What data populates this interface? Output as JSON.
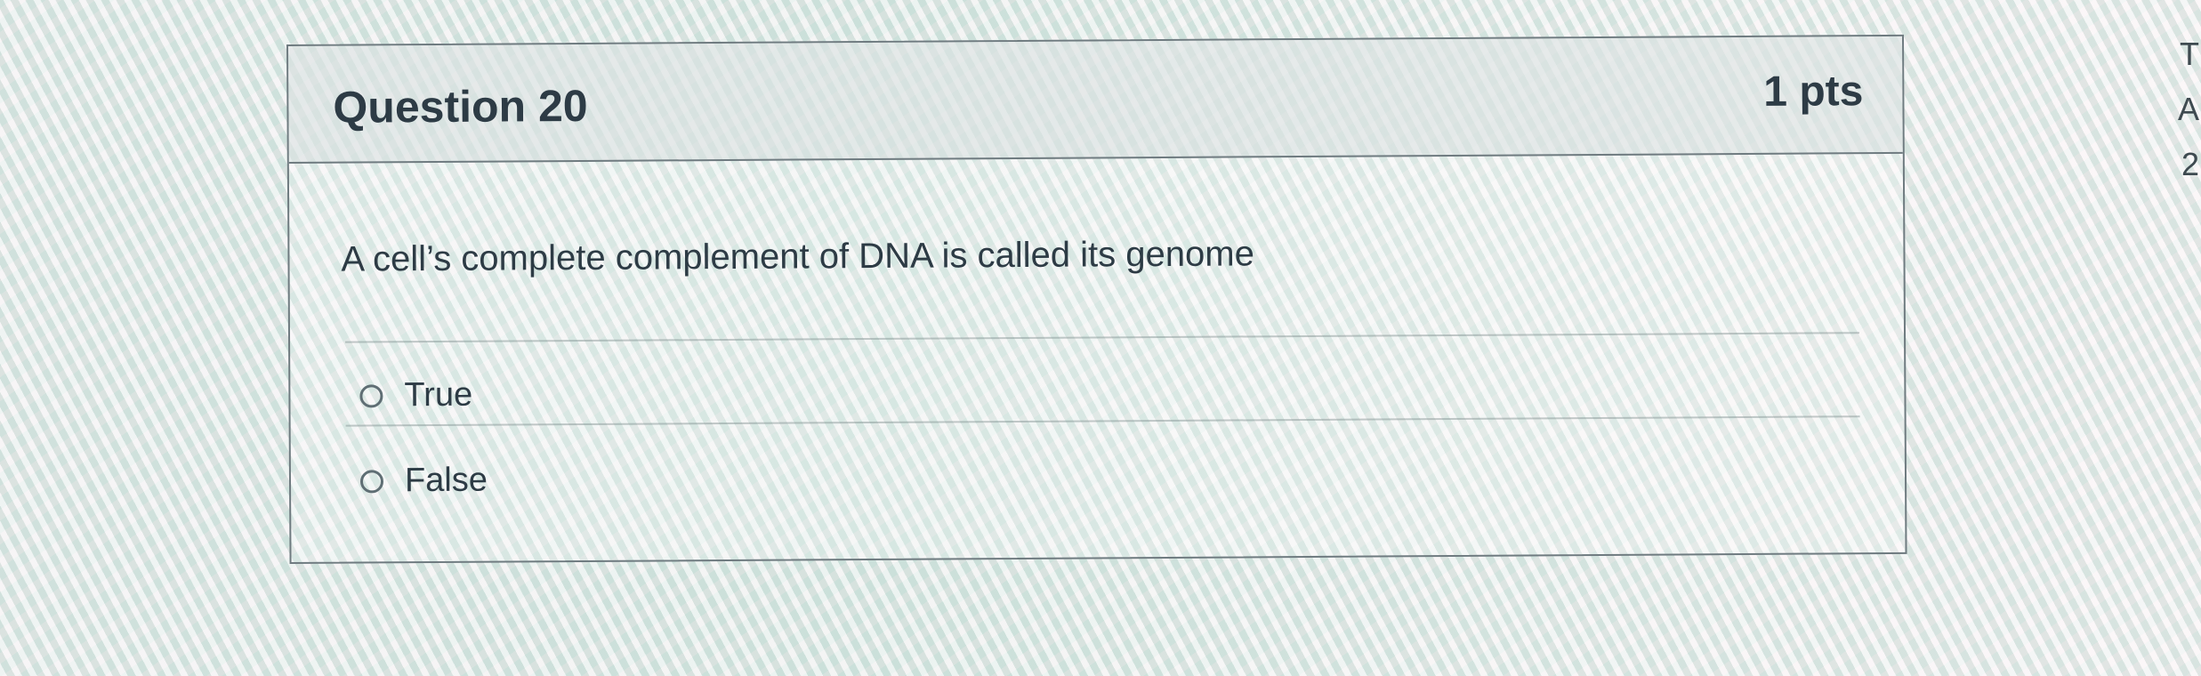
{
  "question": {
    "title": "Question 20",
    "points": "1 pts",
    "text": "A cell’s complete complement of DNA is called its genome",
    "answers": [
      {
        "label": "True",
        "selected": false
      },
      {
        "label": "False",
        "selected": false
      }
    ]
  },
  "side_panel": {
    "letters": [
      "T",
      "A",
      "2"
    ]
  }
}
